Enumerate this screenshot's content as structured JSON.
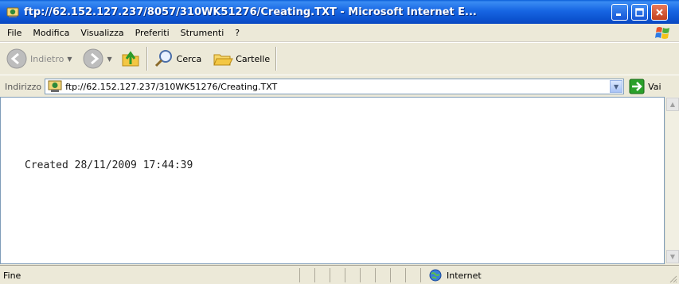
{
  "window": {
    "title": "ftp://62.152.127.237/8057/310WK51276/Creating.TXT - Microsoft Internet E...",
    "title_icon": "ie-ftp-icon"
  },
  "menu": {
    "items": [
      "File",
      "Modifica",
      "Visualizza",
      "Preferiti",
      "Strumenti",
      "?"
    ]
  },
  "toolbar": {
    "back_label": "Indietro",
    "search_label": "Cerca",
    "folders_label": "Cartelle"
  },
  "address": {
    "label": "Indirizzo",
    "url": "ftp://62.152.127.237/310WK51276/Creating.TXT",
    "go_label": "Vai"
  },
  "content": {
    "text": "Created 28/11/2009 17:44:39"
  },
  "status": {
    "text": "Fine",
    "zone": "Internet"
  },
  "colors": {
    "titlebar": "#0c53d0",
    "close_button": "#c4401d",
    "go_arrow": "#2aa02a"
  }
}
